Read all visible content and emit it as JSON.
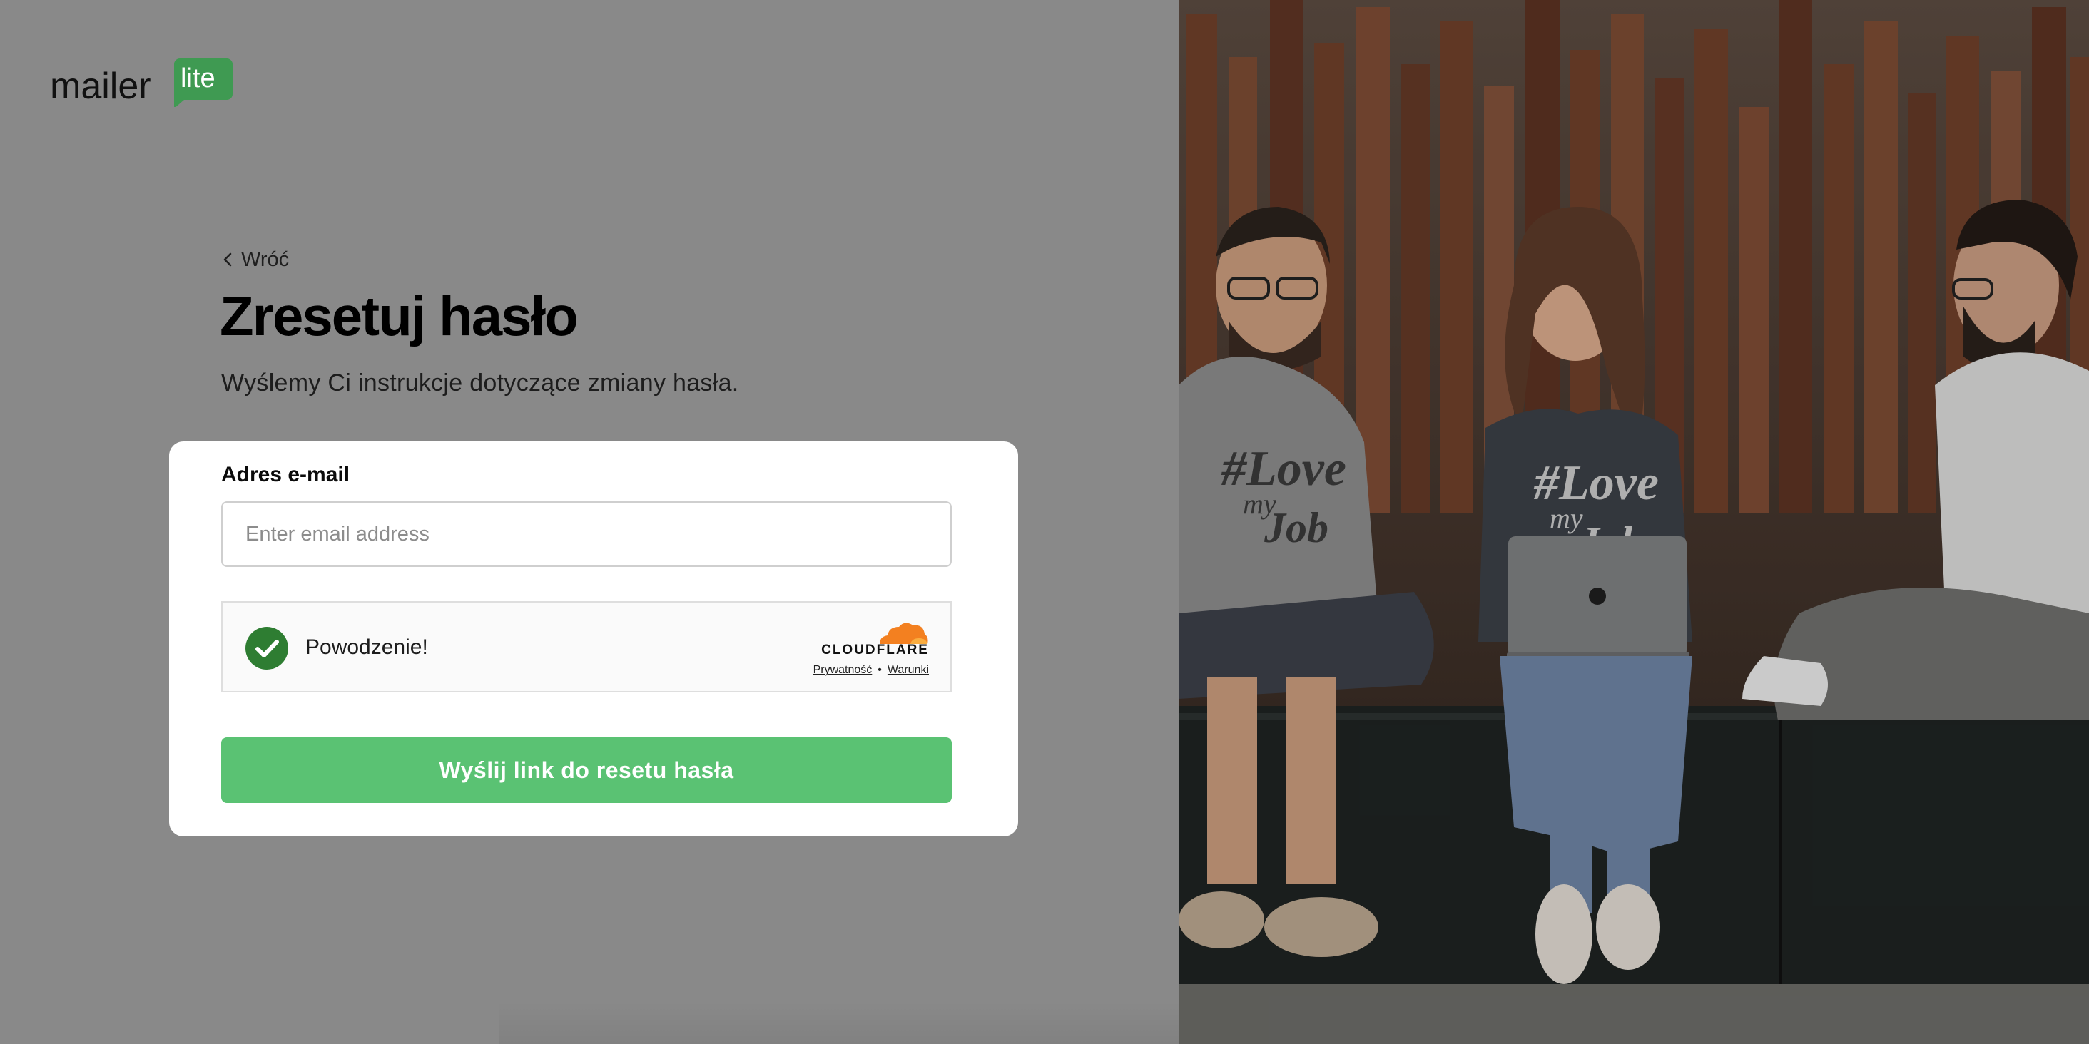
{
  "brand": {
    "logo_word": "mailer",
    "logo_badge": "lite",
    "accent_color": "#5ac273",
    "badge_color": "#3f9a52"
  },
  "nav": {
    "back_label": "Wróć"
  },
  "page": {
    "title": "Zresetuj hasło",
    "subtitle": "Wyślemy Ci instrukcje dotyczące zmiany hasła."
  },
  "form": {
    "email_label": "Adres e-mail",
    "email_value": "",
    "email_placeholder": "Enter email address",
    "submit_label": "Wyślij link do resetu hasła"
  },
  "captcha": {
    "status_text": "Powodzenie!",
    "status": "success",
    "provider": "CLOUDFLARE",
    "privacy_link": "Prywatność",
    "separator": "•",
    "terms_link": "Warunki"
  },
  "hero_image": {
    "shirt_text_line1": "#Love",
    "shirt_text_line2": "my",
    "shirt_text_line3": "Job"
  }
}
